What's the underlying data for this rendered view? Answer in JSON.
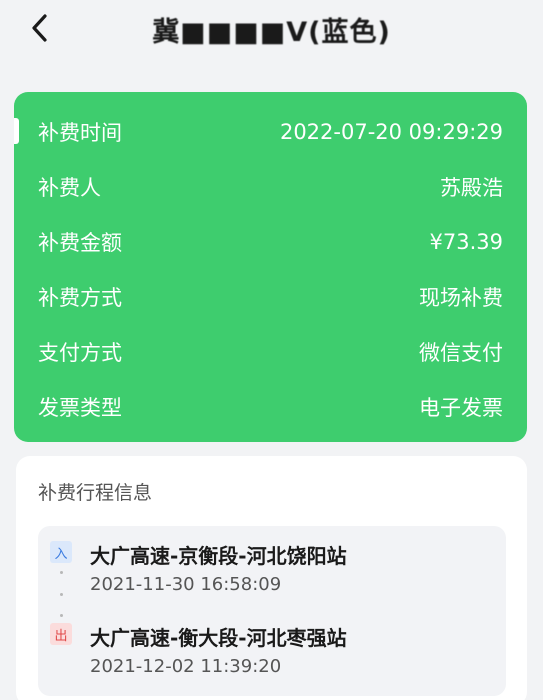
{
  "header": {
    "title": "冀■■■■V(蓝色)"
  },
  "payment": {
    "rows": [
      {
        "label": "补费时间",
        "value": "2022-07-20 09:29:29"
      },
      {
        "label": "补费人",
        "value": "苏殿浩"
      },
      {
        "label": "补费金额",
        "value": "¥73.39"
      },
      {
        "label": "补费方式",
        "value": "现场补费"
      },
      {
        "label": "支付方式",
        "value": "微信支付"
      },
      {
        "label": "发票类型",
        "value": "电子发票"
      }
    ],
    "card_color": "#3ecd6e"
  },
  "trip": {
    "title": "补费行程信息",
    "entry": {
      "tag": "入",
      "station": "大广高速-京衡段-河北饶阳站",
      "time": "2021-11-30 16:58:09"
    },
    "exit": {
      "tag": "出",
      "station": "大广高速-衡大段-河北枣强站",
      "time": "2021-12-02 11:39:20"
    }
  }
}
